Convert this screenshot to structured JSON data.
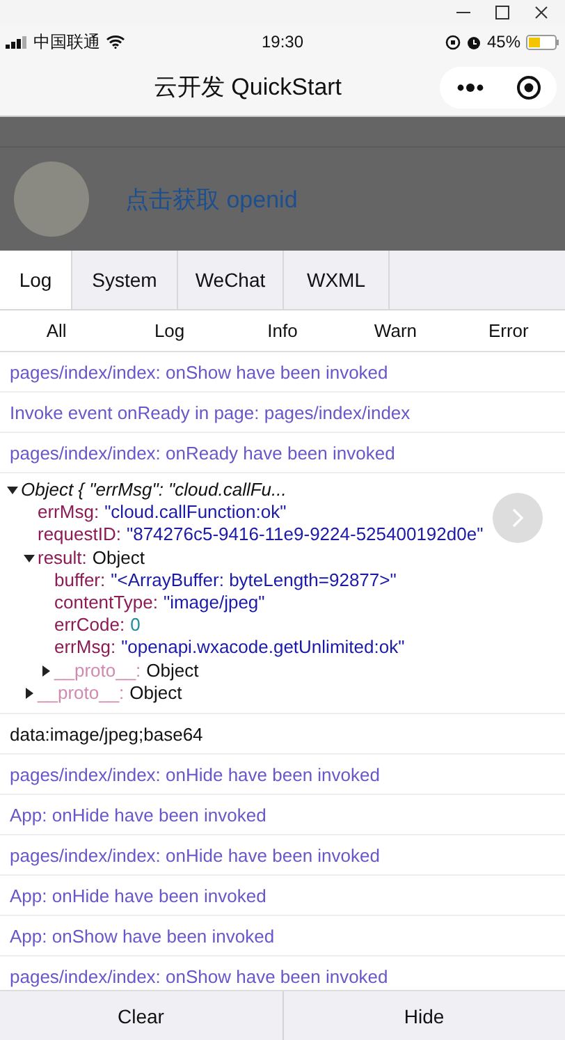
{
  "status_bar": {
    "carrier": "中国联通",
    "time": "19:30",
    "battery": "45%"
  },
  "nav_bar": {
    "title": "云开发 QuickStart"
  },
  "header": {
    "link": "点击获取 openid"
  },
  "tabs": [
    {
      "label": "Log",
      "selected": true
    },
    {
      "label": "System",
      "selected": false
    },
    {
      "label": "WeChat",
      "selected": false
    },
    {
      "label": "WXML",
      "selected": false
    }
  ],
  "filters": [
    {
      "label": "All",
      "selected": false
    },
    {
      "label": "Log",
      "selected": false
    },
    {
      "label": "Info",
      "selected": false
    },
    {
      "label": "Warn",
      "selected": false
    },
    {
      "label": "Error",
      "selected": false
    }
  ],
  "logs": [
    {
      "kind": "log",
      "text": "pages/index/index: onShow have been invoked"
    },
    {
      "kind": "log",
      "text": "Invoke event onReady in page: pages/index/index"
    },
    {
      "kind": "log",
      "text": "pages/index/index: onReady have been invoked"
    },
    {
      "kind": "object",
      "summary": "Object { \"errMsg\": \"cloud.callFu...",
      "expanded": true,
      "children": [
        {
          "key": "errMsg:",
          "value": "\"cloud.callFunction:ok\"",
          "kind": "string"
        },
        {
          "key": "requestID:",
          "value": "\"874276c5-9416-11e9-9224-525400192d0e\"",
          "kind": "string"
        },
        {
          "key": "result:",
          "value": "Object",
          "kind": "object",
          "expanded": true,
          "children": [
            {
              "key": "buffer:",
              "value": "\"<ArrayBuffer: byteLength=92877>\"",
              "kind": "string"
            },
            {
              "key": "contentType:",
              "value": "\"image/jpeg\"",
              "kind": "string"
            },
            {
              "key": "errCode:",
              "value": "0",
              "kind": "number"
            },
            {
              "key": "errMsg:",
              "value": "\"openapi.wxacode.getUnlimited:ok\"",
              "kind": "string"
            },
            {
              "key": "__proto__:",
              "value": "Object",
              "kind": "proto",
              "expanded": false
            }
          ]
        },
        {
          "key": "__proto__:",
          "value": "Object",
          "kind": "proto",
          "expanded": false
        }
      ]
    },
    {
      "kind": "plain",
      "text": "data:image/jpeg;base64"
    },
    {
      "kind": "log",
      "text": "pages/index/index: onHide have been invoked"
    },
    {
      "kind": "log",
      "text": "App: onHide have been invoked"
    },
    {
      "kind": "log",
      "text": "pages/index/index: onHide have been invoked"
    },
    {
      "kind": "log",
      "text": "App: onHide have been invoked"
    },
    {
      "kind": "log",
      "text": "App: onShow have been invoked"
    },
    {
      "kind": "log",
      "text": "pages/index/index: onShow have been invoked"
    }
  ],
  "bottom_bar": [
    "Clear",
    "Hide"
  ]
}
